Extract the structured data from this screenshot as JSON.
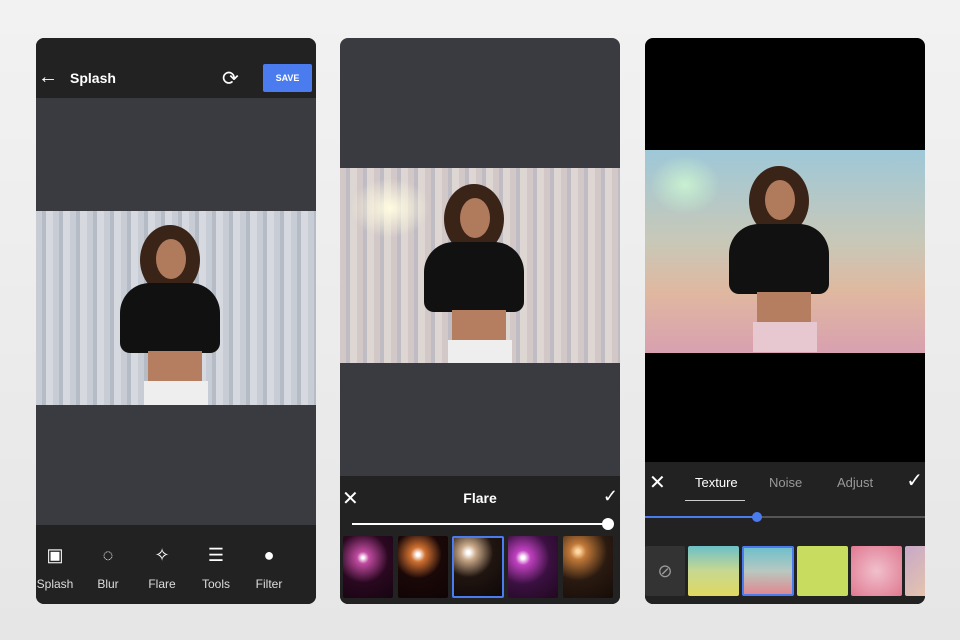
{
  "screen1": {
    "title": "Splash",
    "save_label": "SAVE",
    "back_icon": "arrow-left-icon",
    "refresh_icon": "sync-icon",
    "tools": [
      {
        "label": "Splash",
        "icon": "splash-icon"
      },
      {
        "label": "Blur",
        "icon": "drop-icon"
      },
      {
        "label": "Flare",
        "icon": "sparkle-icon"
      },
      {
        "label": "Tools",
        "icon": "sliders-icon"
      },
      {
        "label": "Filter",
        "icon": "circles-icon"
      }
    ]
  },
  "screen2": {
    "title": "Flare",
    "slider_value": 1.0,
    "selected_thumb": 2
  },
  "screen3": {
    "tabs": [
      "Texture",
      "Noise",
      "Adjust"
    ],
    "active_tab": "Texture",
    "slider_value": 0.4,
    "selected_thumb": 2
  },
  "colors": {
    "accent": "#4a7cf0",
    "bar": "#222222"
  }
}
